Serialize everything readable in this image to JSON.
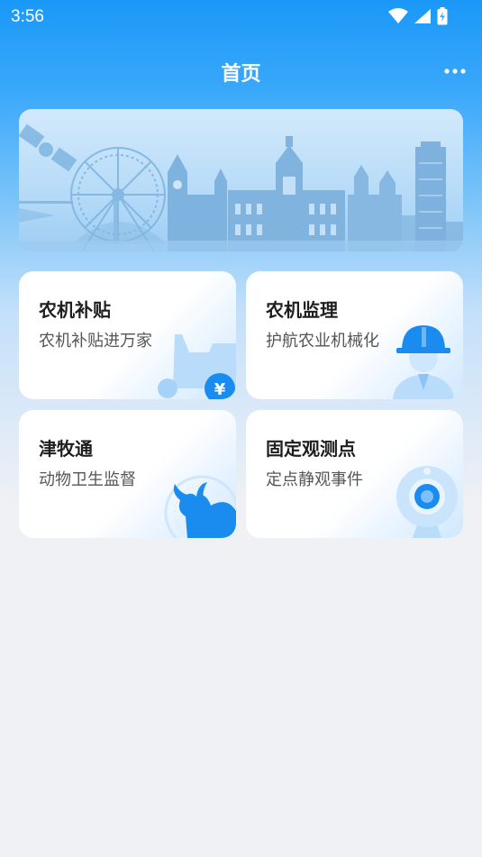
{
  "status": {
    "time": "3:56"
  },
  "header": {
    "title": "首页"
  },
  "cards": [
    {
      "title": "农机补贴",
      "subtitle": "农机补贴进万家",
      "icon": "tractor-yen-icon"
    },
    {
      "title": "农机监理",
      "subtitle": "护航农业机械化",
      "icon": "worker-helmet-icon"
    },
    {
      "title": "津牧通",
      "subtitle": "动物卫生监督",
      "icon": "cow-icon"
    },
    {
      "title": "固定观测点",
      "subtitle": "定点静观事件",
      "icon": "webcam-icon"
    }
  ],
  "colors": {
    "primary": "#1a98f8",
    "icon_blue": "#1a8cf0",
    "background": "#eff1f5"
  }
}
